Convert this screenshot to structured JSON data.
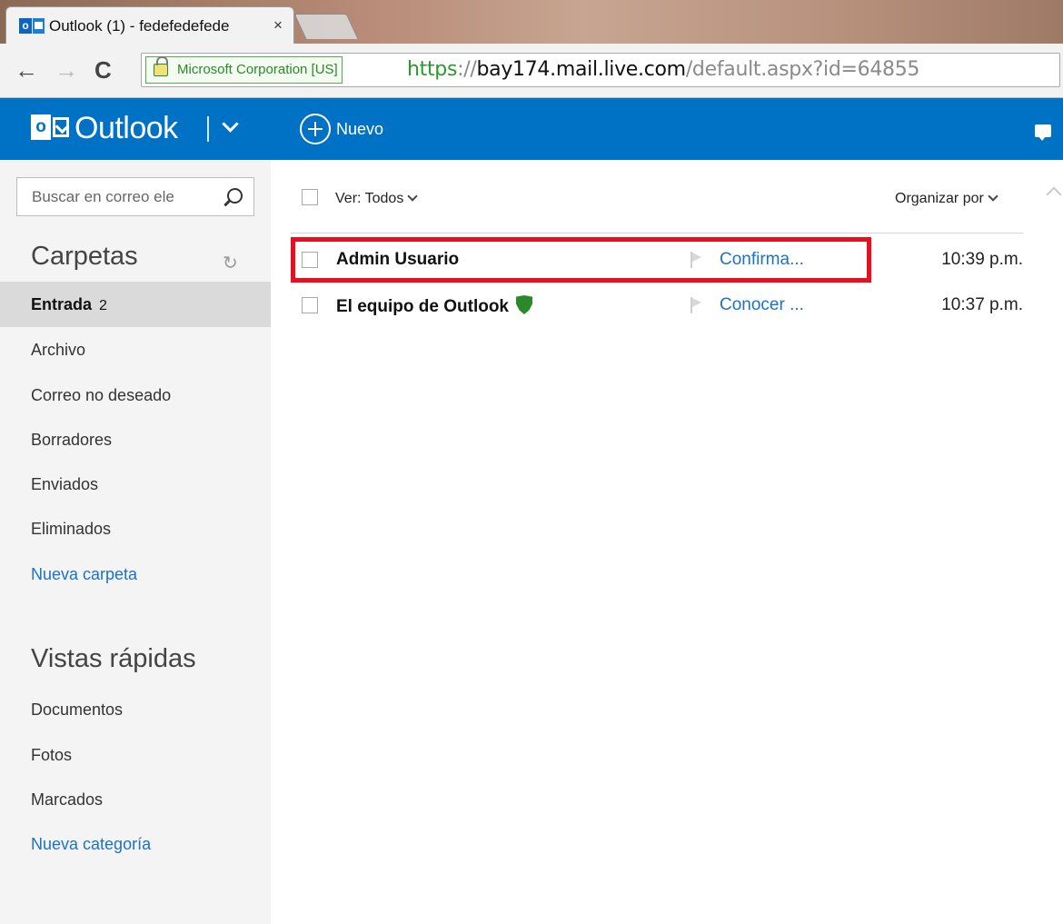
{
  "browser": {
    "tab_title": "Outlook (1) - fedefedefede",
    "tab_close": "×",
    "favicon_letter": "o",
    "ev_cert": "Microsoft Corporation [US]",
    "url": {
      "scheme": "https",
      "separator": "://",
      "host": "bay174.mail.live.com",
      "path": "/default.aspx?id=64855"
    },
    "nav": {
      "back": "←",
      "forward": "→",
      "reload": "C"
    }
  },
  "header": {
    "logo_letter": "o",
    "brand": "Outlook",
    "new_label": "Nuevo",
    "brand_color": "#0072c6"
  },
  "search": {
    "placeholder": "Buscar en correo ele"
  },
  "folders": {
    "heading": "Carpetas",
    "refresh_icon": "↻",
    "items": [
      {
        "label": "Entrada",
        "count": "2",
        "selected": true
      },
      {
        "label": "Archivo"
      },
      {
        "label": "Correo no deseado"
      },
      {
        "label": "Borradores"
      },
      {
        "label": "Enviados"
      },
      {
        "label": "Eliminados"
      },
      {
        "label": "Nueva carpeta",
        "link": true
      }
    ]
  },
  "quick_views": {
    "heading": "Vistas rápidas",
    "items": [
      {
        "label": "Documentos"
      },
      {
        "label": "Fotos"
      },
      {
        "label": "Marcados"
      },
      {
        "label": "Nueva categoría",
        "link": true
      }
    ]
  },
  "message_list": {
    "filter_label": "Ver: Todos",
    "sort_label": "Organizar por",
    "messages": [
      {
        "sender": "Admin Usuario",
        "subject": "Confirma...",
        "time": "10:39 p.m.",
        "highlighted": true
      },
      {
        "sender": "El equipo de Outlook",
        "subject": "Conocer ...",
        "time": "10:37 p.m.",
        "verified": true
      }
    ]
  },
  "colors": {
    "accent": "#0072c6",
    "link": "#1a73c6",
    "highlight": "#e8101e",
    "verified_shield": "#2a8a2a"
  }
}
